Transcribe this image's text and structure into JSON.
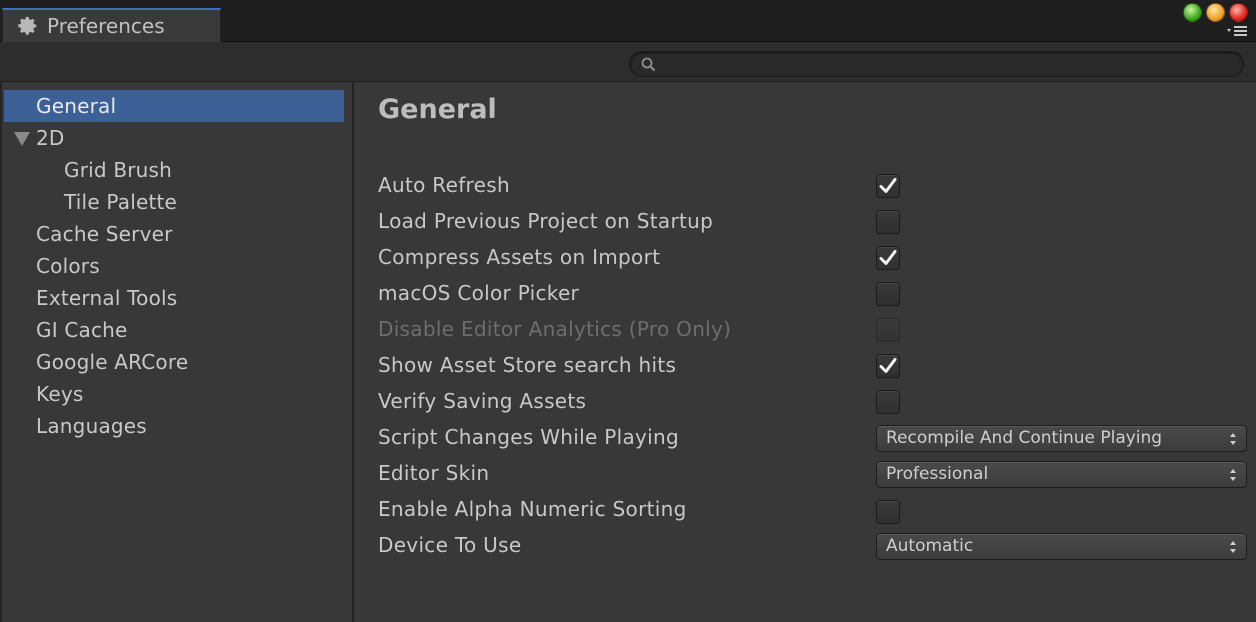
{
  "window": {
    "tab_title": "Preferences"
  },
  "search": {
    "placeholder": "",
    "value": ""
  },
  "sidebar": {
    "items": [
      {
        "label": "General",
        "selected": true
      },
      {
        "label": "2D",
        "expanded": true
      },
      {
        "label": "Grid Brush"
      },
      {
        "label": "Tile Palette"
      },
      {
        "label": "Cache Server"
      },
      {
        "label": "Colors"
      },
      {
        "label": "External Tools"
      },
      {
        "label": "GI Cache"
      },
      {
        "label": "Google ARCore"
      },
      {
        "label": "Keys"
      },
      {
        "label": "Languages"
      }
    ]
  },
  "main": {
    "title": "General",
    "settings": [
      {
        "label": "Auto Refresh",
        "type": "checkbox",
        "checked": true
      },
      {
        "label": "Load Previous Project on Startup",
        "type": "checkbox",
        "checked": false
      },
      {
        "label": "Compress Assets on Import",
        "type": "checkbox",
        "checked": true
      },
      {
        "label": "macOS Color Picker",
        "type": "checkbox",
        "checked": false
      },
      {
        "label": "Disable Editor Analytics (Pro Only)",
        "type": "checkbox",
        "checked": false,
        "disabled": true
      },
      {
        "label": "Show Asset Store search hits",
        "type": "checkbox",
        "checked": true
      },
      {
        "label": "Verify Saving Assets",
        "type": "checkbox",
        "checked": false
      },
      {
        "label": "Script Changes While Playing",
        "type": "dropdown",
        "value": "Recompile And Continue Playing"
      },
      {
        "label": "Editor Skin",
        "type": "dropdown",
        "value": "Professional"
      },
      {
        "label": "Enable Alpha Numeric Sorting",
        "type": "checkbox",
        "checked": false
      },
      {
        "label": "Device To Use",
        "type": "dropdown",
        "value": "Automatic"
      }
    ]
  },
  "colors": {
    "selection": "#3d6097",
    "tab_accent": "#3d6fbf",
    "background": "#383838"
  }
}
